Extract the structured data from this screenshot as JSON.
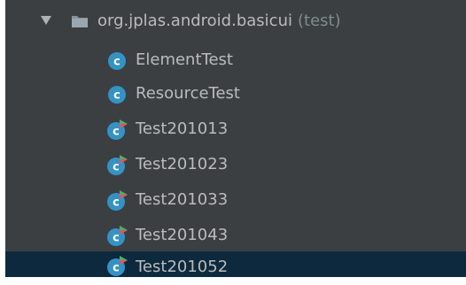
{
  "tree": {
    "package": {
      "name": "org.jplas.android.basicui",
      "suffix": "(test)",
      "expanded": true
    },
    "items": [
      {
        "label": "ElementTest",
        "icon": "class-icon",
        "runnable": false
      },
      {
        "label": "ResourceTest",
        "icon": "class-icon",
        "runnable": false
      },
      {
        "label": "Test201013",
        "icon": "test-class-icon",
        "runnable": true
      },
      {
        "label": "Test201023",
        "icon": "test-class-icon",
        "runnable": true
      },
      {
        "label": "Test201033",
        "icon": "test-class-icon",
        "runnable": true
      },
      {
        "label": "Test201043",
        "icon": "test-class-icon",
        "runnable": true
      },
      {
        "label": "Test201052",
        "icon": "test-class-icon",
        "runnable": true,
        "selected": true
      }
    ]
  },
  "colors": {
    "panel_bg": "#3c3f41",
    "selection_bg": "#0d293e",
    "text": "#bbbbbb",
    "suffix_text": "#7e8d8f",
    "class_icon": "#3592c4",
    "run_badge_green": "#59a869",
    "run_badge_red": "#db5860"
  }
}
